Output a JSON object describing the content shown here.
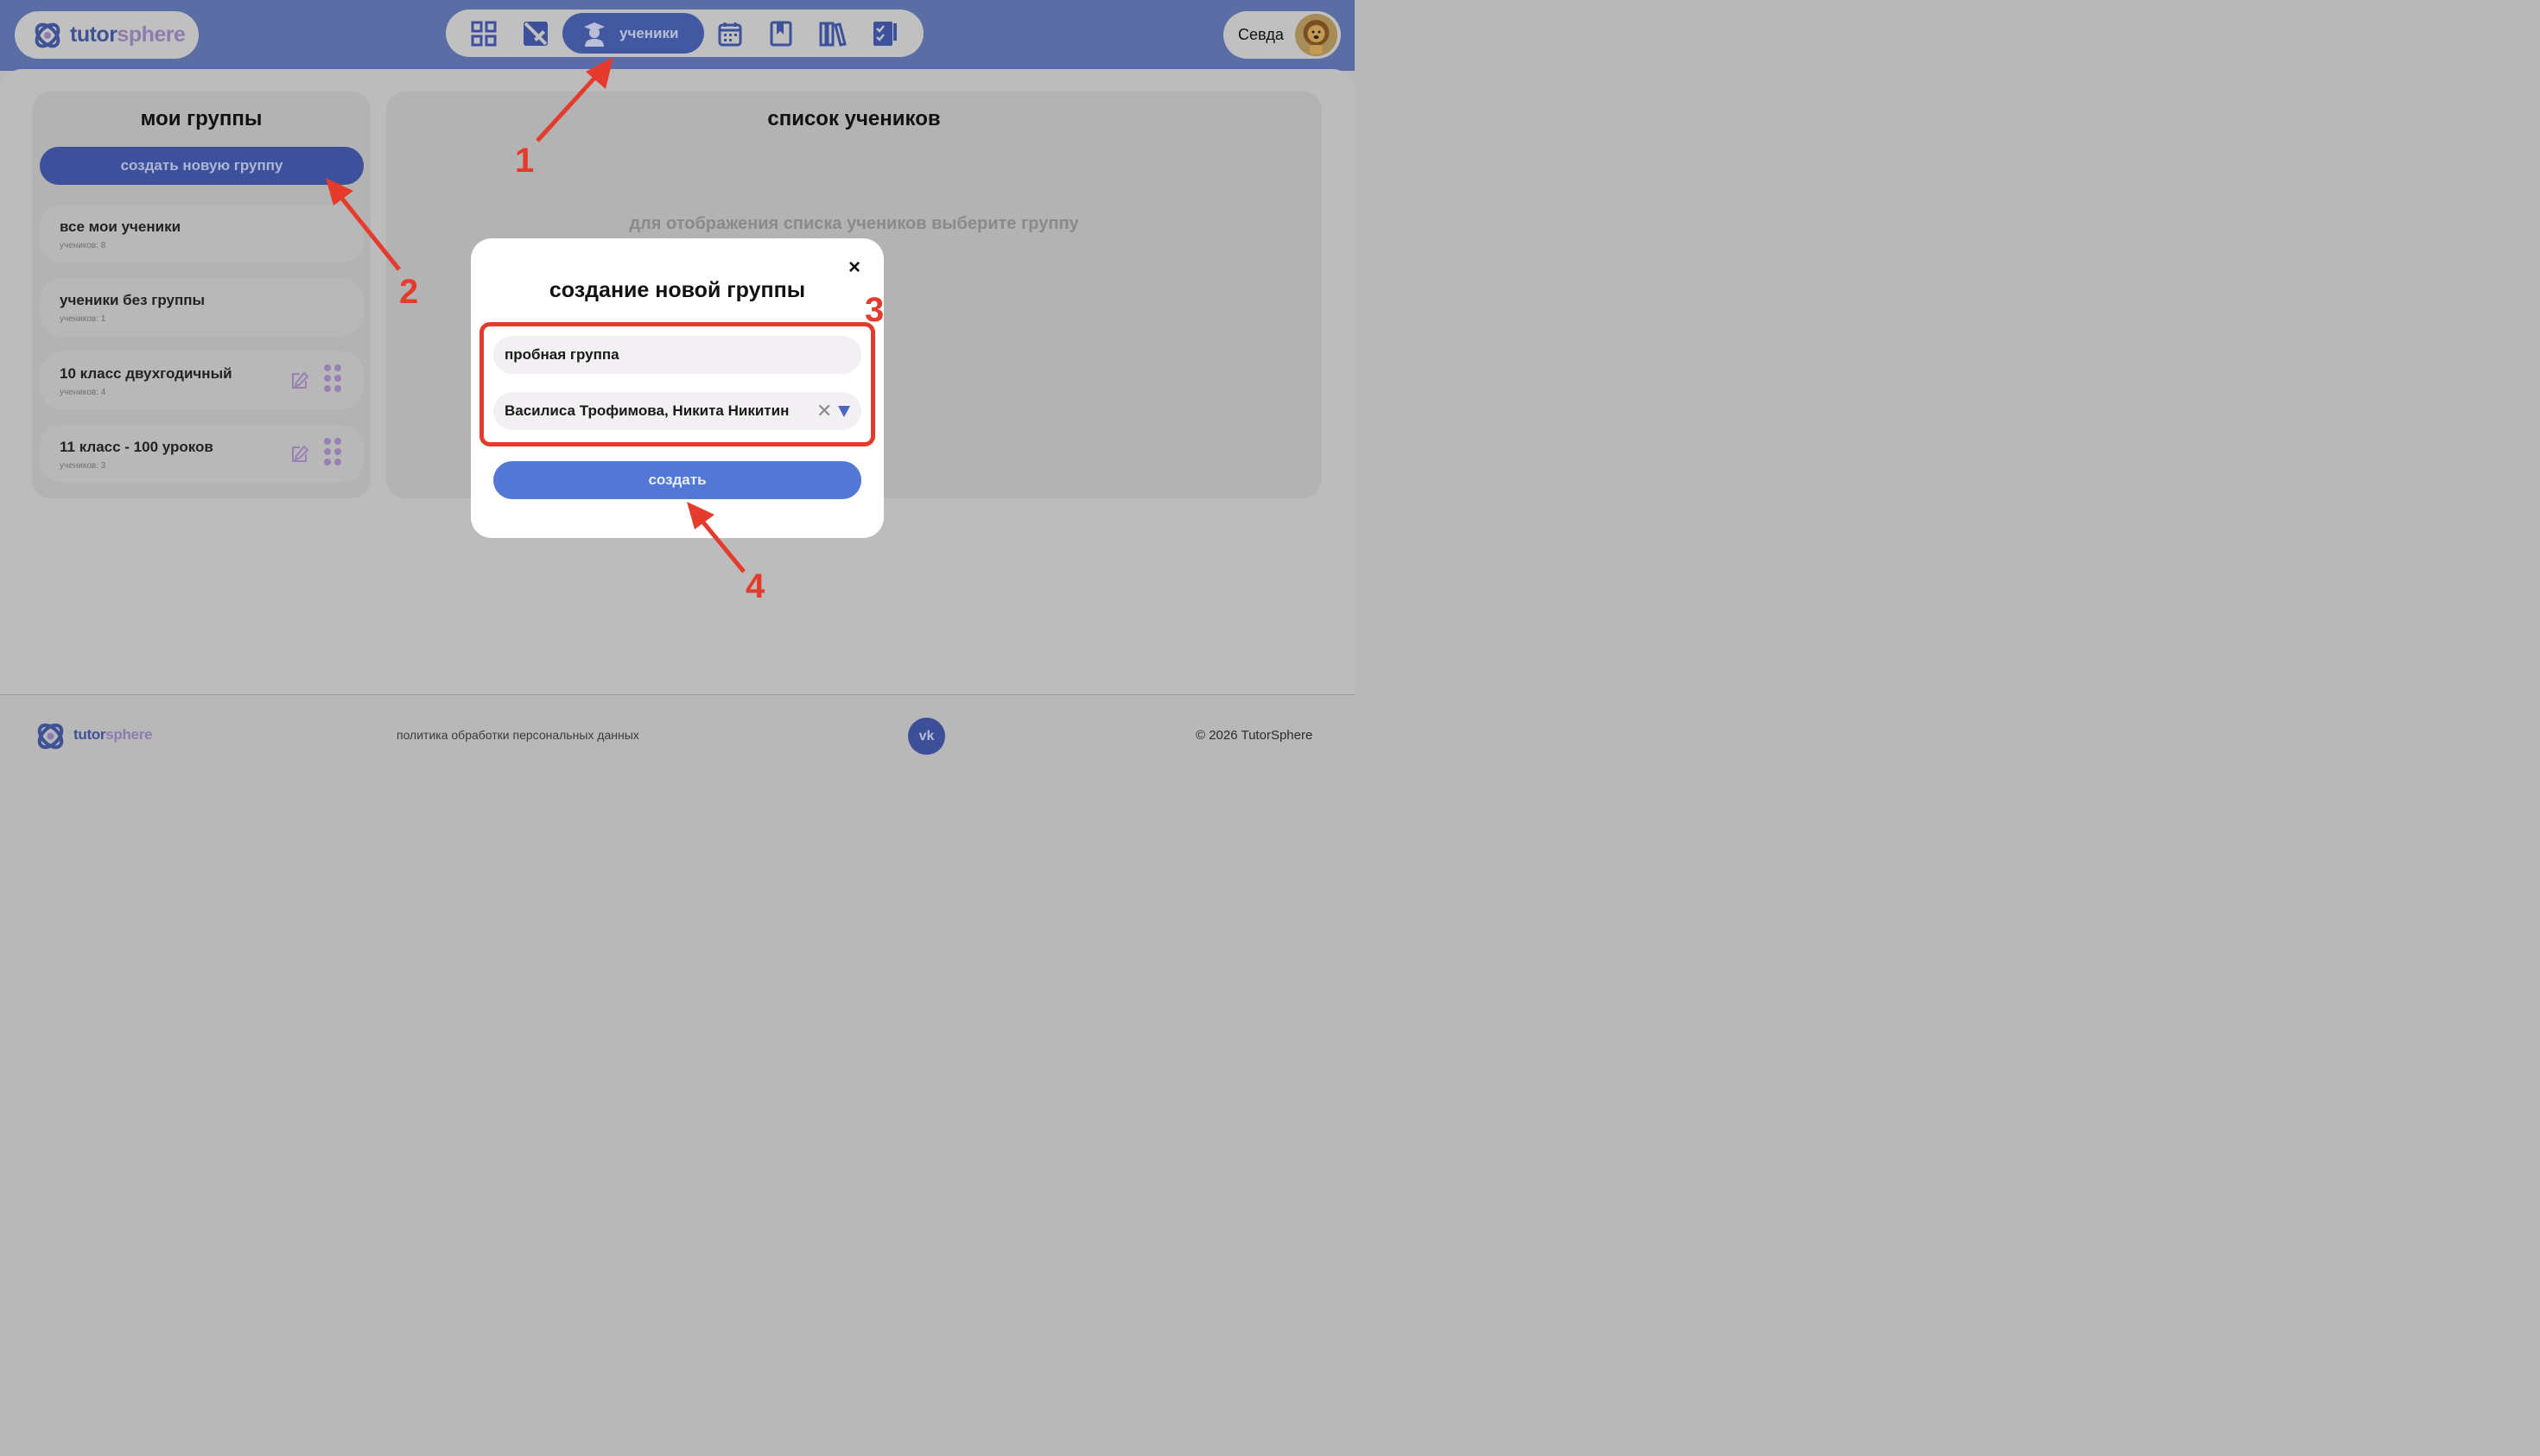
{
  "header": {
    "logo_text_a": "tutor",
    "logo_text_b": "sphere",
    "nav_items": [
      "dashboard-icon",
      "homework-icon",
      "students-icon",
      "calendar-icon",
      "bookmark-icon",
      "library-icon",
      "tasks-icon"
    ],
    "nav_active_label": "ученики",
    "user_name": "Севда"
  },
  "left_panel": {
    "title": "мои группы",
    "create_button": "создать новую группу",
    "groups": [
      {
        "name": "все мои ученики",
        "count": "учеников: 8"
      },
      {
        "name": "ученики без группы",
        "count": "учеников: 1"
      },
      {
        "name": "10 класс двухгодичный",
        "count": "учеников: 4"
      },
      {
        "name": "11 класс - 100 уроков",
        "count": "учеников: 3"
      }
    ]
  },
  "right_panel": {
    "title": "список учеников",
    "empty_hint": "для отображения списка учеников выберите группу"
  },
  "modal": {
    "title": "создание новой группы",
    "close": "×",
    "group_name_value": "пробная группа",
    "students_value": "Василиса Трофимова, Никита Никитин",
    "clear": "✕",
    "submit": "создать"
  },
  "annotations": [
    "1",
    "2",
    "3",
    "4"
  ],
  "footer": {
    "logo_text_a": "tutor",
    "logo_text_b": "sphere",
    "policy": "политика обработки персональных данных",
    "vk": "vk",
    "copyright": "© 2026 TutorSphere"
  },
  "colors": {
    "accent": "#3d509b",
    "button": "#5277d4",
    "annotation": "#e53b2c",
    "overlay_bg": "#b9b9b9"
  }
}
